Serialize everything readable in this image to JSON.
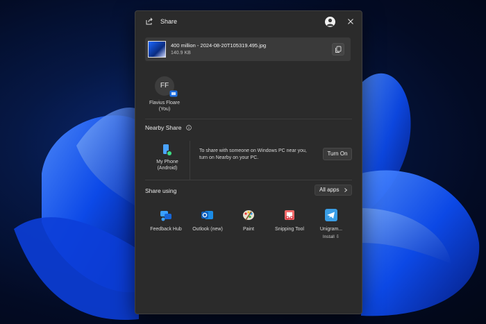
{
  "window": {
    "title": "Share",
    "title_icon": "share-icon",
    "close_icon": "close-icon"
  },
  "file": {
    "name": "400 million - 2024-08-20T105319.495.jpg",
    "size": "140.9 KB",
    "copy_icon": "copy-icon"
  },
  "contacts": [
    {
      "initials": "FF",
      "name_line1": "Flavius Floare",
      "name_line2": "(You)"
    }
  ],
  "nearby": {
    "label": "Nearby Share",
    "device_line1": "My Phone",
    "device_line2": "(Android)",
    "message_line1": "To share with someone on Windows PC near you,",
    "message_line2": "turn on Nearby on your PC.",
    "button": "Turn On"
  },
  "share_using": {
    "label": "Share using",
    "all_apps": "All apps",
    "apps": [
      {
        "label": "Feedback Hub",
        "icon": "feedback-hub-icon"
      },
      {
        "label": "Outlook (new)",
        "icon": "outlook-icon"
      },
      {
        "label": "Paint",
        "icon": "paint-icon"
      },
      {
        "label": "Snipping Tool",
        "icon": "snipping-tool-icon"
      },
      {
        "label": "Unigram...",
        "icon": "unigram-icon",
        "sub": "Install"
      }
    ]
  },
  "colors": {
    "window_bg": "#2b2b2b",
    "card_bg": "#3a3a3a",
    "accent_blue": "#1a66ff"
  }
}
